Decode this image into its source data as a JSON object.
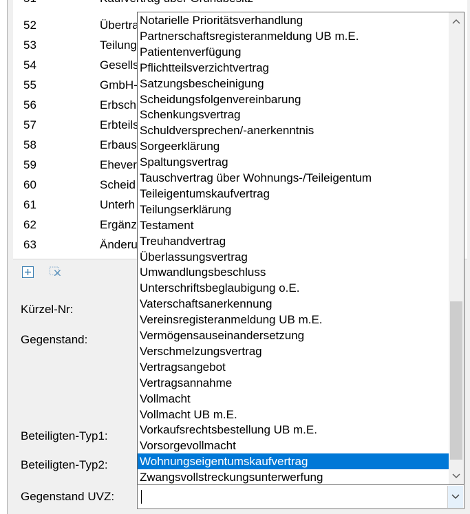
{
  "background_list": {
    "partial_top_text": "Kaufvertrag über Grundbesitz",
    "rows": [
      {
        "num": "52",
        "text": "Übertra"
      },
      {
        "num": "53",
        "text": "Teilung"
      },
      {
        "num": "54",
        "text": "Gesells"
      },
      {
        "num": "55",
        "text": "GmbH-"
      },
      {
        "num": "56",
        "text": "Erbsch"
      },
      {
        "num": "57",
        "text": "Erbteils"
      },
      {
        "num": "58",
        "text": "Erbaus"
      },
      {
        "num": "59",
        "text": "Ehever"
      },
      {
        "num": "60",
        "text": "Scheid"
      },
      {
        "num": "61",
        "text": "Unterh"
      },
      {
        "num": "62",
        "text": "Ergänz"
      },
      {
        "num": "63",
        "text": "Änderu"
      }
    ]
  },
  "toolbar": {
    "add_icon": "plus-box-icon",
    "remove_icon": "dashed-x-icon"
  },
  "form": {
    "kuerzel_label": "Kürzel-Nr:",
    "gegenstand_label": "Gegenstand:",
    "typ1_label": "Beteiligten-Typ1:",
    "typ2_label": "Beteiligten-Typ2:",
    "gegenstand_uvz_label": "Gegenstand UVZ:",
    "gegenstand_uvz_value": ""
  },
  "dropdown": {
    "selected_index": 28,
    "items": [
      "Notarielle Prioritätsverhandlung",
      "Partnerschaftsregisteranmeldung UB m.E.",
      "Patientenverfügung",
      "Pflichtteilsverzichtvertrag",
      "Satzungsbescheinigung",
      "Scheidungsfolgenvereinbarung",
      "Schenkungsvertrag",
      "Schuldversprechen/-anerkenntnis",
      "Sorgeerklärung",
      "Spaltungsvertrag",
      "Tauschvertrag über Wohnungs-/Teileigentum",
      "Teileigentumskaufvertrag",
      "Teilungserklärung",
      "Testament",
      "Treuhandvertrag",
      "Überlassungsvertrag",
      "Umwandlungsbeschluss",
      "Unterschriftsbeglaubigung o.E.",
      "Vaterschaftsanerkennung",
      "Vereinsregisteranmeldung UB m.E.",
      "Vermögensauseinandersetzung",
      "Verschmelzungsvertrag",
      "Vertragsangebot",
      "Vertragsannahme",
      "Vollmacht",
      "Vollmacht UB m.E.",
      "Vorkaufsrechtsbestellung UB m.E.",
      "Vorsorgevollmacht",
      "Wohnungseigentumskaufvertrag",
      "Zwangsvollstreckungsunterwerfung"
    ],
    "scrollbar": {
      "up_icon": "chevron-up-icon",
      "down_icon": "chevron-down-icon"
    }
  },
  "colors": {
    "selection": "#0078d7",
    "window_bg": "#f0f0f0",
    "scroll_thumb": "#cdcdcd"
  }
}
